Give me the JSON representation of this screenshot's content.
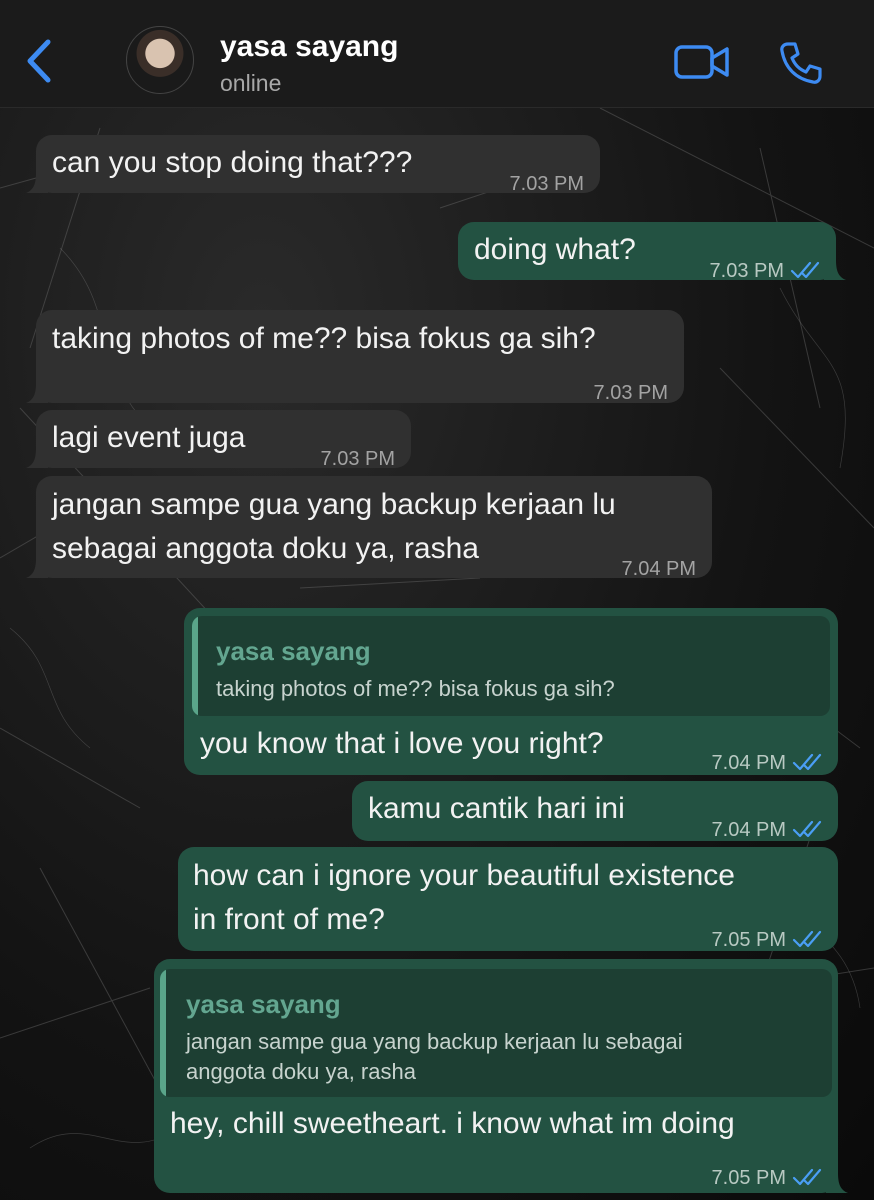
{
  "header": {
    "contact_name": "yasa sayang",
    "status": "online",
    "back_icon": "chevron-left-icon",
    "video_icon": "video-camera-icon",
    "call_icon": "phone-icon",
    "accent_color": "#3d8bf2"
  },
  "messages": [
    {
      "direction": "in",
      "text": "can you stop doing that???",
      "time": "7.03 PM"
    },
    {
      "direction": "out",
      "text": "doing what?",
      "time": "7.03 PM"
    },
    {
      "direction": "in",
      "text": "taking photos of me?? bisa fokus ga sih?",
      "time": "7.03 PM"
    },
    {
      "direction": "in",
      "text": "lagi event juga",
      "time": "7.03 PM"
    },
    {
      "direction": "in",
      "lines": [
        "jangan sampe gua yang backup kerjaan lu",
        "sebagai anggota doku ya, rasha"
      ],
      "time": "7.04 PM"
    },
    {
      "direction": "out",
      "quote": {
        "name": "yasa sayang",
        "text": "taking photos of me?? bisa fokus ga sih?"
      },
      "text": "you know that i love you right?",
      "time": "7.04 PM"
    },
    {
      "direction": "out",
      "text": "kamu cantik hari ini",
      "time": "7.04 PM"
    },
    {
      "direction": "out",
      "lines": [
        "how can i ignore your beautiful existence",
        "in front of me?"
      ],
      "time": "7.05 PM"
    },
    {
      "direction": "out",
      "quote": {
        "name": "yasa sayang",
        "lines": [
          "jangan sampe gua yang backup kerjaan lu sebagai",
          "anggota doku ya, rasha"
        ]
      },
      "text": "hey, chill sweetheart. i know what im doing",
      "time": "7.05 PM"
    }
  ],
  "colors": {
    "incoming_bubble": "#303030",
    "outgoing_bubble": "#235242",
    "quote_name": "#63a690",
    "read_ticks": "#4a9ef5"
  }
}
